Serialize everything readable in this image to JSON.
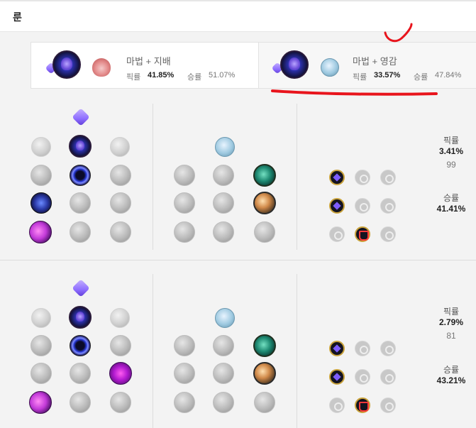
{
  "header": {
    "title": "룬"
  },
  "tabs": [
    {
      "title": "마법 + 지배",
      "pick_label": "픽률",
      "pick_value": "41.85%",
      "win_label": "승률",
      "win_value": "51.07%"
    },
    {
      "title": "마법 + 영감",
      "pick_label": "픽률",
      "pick_value": "33.57%",
      "win_label": "승률",
      "win_value": "47.84%"
    }
  ],
  "builds": [
    {
      "pick_label": "픽률",
      "pick_value": "3.41%",
      "games": "99",
      "win_label": "승률",
      "win_value": "41.41%"
    },
    {
      "pick_label": "픽률",
      "pick_value": "2.79%",
      "games": "81",
      "win_label": "승률",
      "win_value": "43.21%"
    }
  ],
  "annotation": {
    "color": "#e8141c"
  },
  "icons": {
    "primary_path": "sorcery-icon",
    "secondary_path": "inspiration-icon",
    "keystone": "summon-aery-icon",
    "shards": [
      "adaptive-force-shard-icon",
      "attack-speed-shard-icon",
      "ability-haste-shard-icon",
      "armor-shard-icon",
      "magic-resist-shard-icon",
      "health-shard-icon"
    ]
  }
}
